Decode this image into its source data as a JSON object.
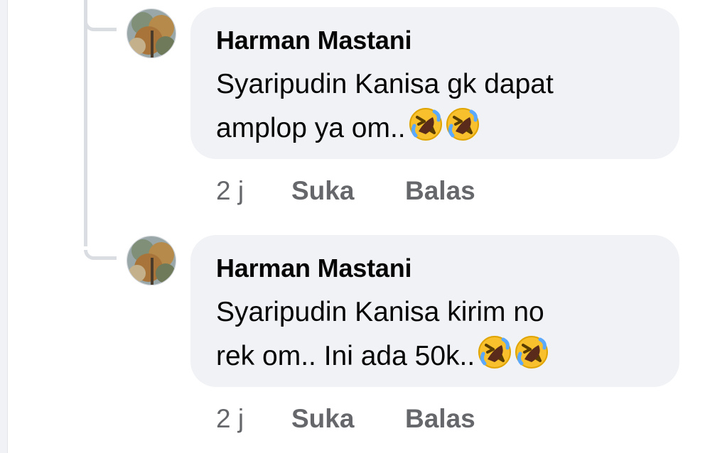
{
  "comments": [
    {
      "author": "Harman Mastani",
      "line1": "Syaripudin Kanisa gk dapat",
      "line2": "amplop ya om..",
      "emojis": [
        "rolling-on-floor-laughing-emoji",
        "rolling-on-floor-laughing-emoji"
      ],
      "time": "2 j",
      "like_label": "Suka",
      "reply_label": "Balas"
    },
    {
      "author": "Harman Mastani",
      "line1": "Syaripudin Kanisa kirim no",
      "line2": "rek om.. Ini ada 50k..",
      "emojis": [
        "rolling-on-floor-laughing-emoji",
        "rolling-on-floor-laughing-emoji"
      ],
      "time": "2 j",
      "like_label": "Suka",
      "reply_label": "Balas"
    }
  ],
  "colors": {
    "bubble_bg": "#f0f2f5",
    "text": "#050505",
    "secondary_text": "#65676b",
    "thread_line": "#dadde1"
  }
}
